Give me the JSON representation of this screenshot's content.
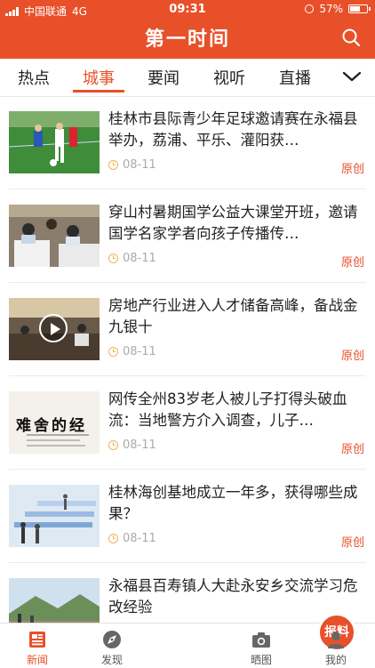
{
  "status_bar": {
    "carrier": "中国联通",
    "network": "4G",
    "time": "09:31",
    "battery": "57%",
    "battery_level": 0.57
  },
  "header": {
    "title": "第一时间",
    "search_icon": "search-icon",
    "brand_color": "#e8502a"
  },
  "tabs": [
    {
      "label": "热点",
      "active": false
    },
    {
      "label": "城事",
      "active": true
    },
    {
      "label": "要闻",
      "active": false
    },
    {
      "label": "视听",
      "active": false
    },
    {
      "label": "直播",
      "active": false
    }
  ],
  "more_icon": "chevron-down-icon",
  "articles": [
    {
      "title": "桂林市县际青少年足球邀请赛在永福县举办，荔浦、平乐、灌阳获…",
      "date": "08-11",
      "tag": "原创"
    },
    {
      "title": " 穿山村暑期国学公益大课堂开班，邀请国学名家学者向孩子传播传…",
      "date": "08-11",
      "tag": "原创"
    },
    {
      "title": "房地产行业进入人才储备高峰，备战金九银十",
      "date": "08-11",
      "tag": "原创",
      "video": true
    },
    {
      "title": "网传全州83岁老人被儿子打得头破血流：当地警方介入调查，儿子…",
      "date": "08-11",
      "tag": "原创",
      "thumb_text": "难舍的经"
    },
    {
      "title": "桂林海创基地成立一年多，获得哪些成果？",
      "date": "08-11",
      "tag": "原创"
    },
    {
      "title": "永福县百寿镇人大赴永安乡交流学习危改经验",
      "date": "",
      "tag": ""
    }
  ],
  "bottom_nav": [
    {
      "label": "新闻",
      "icon": "news-icon",
      "active": true
    },
    {
      "label": "发现",
      "icon": "compass-icon",
      "active": false
    },
    {
      "label": "报料",
      "icon": "report-button",
      "active": false
    },
    {
      "label": "晒图",
      "icon": "camera-icon",
      "active": false
    },
    {
      "label": "我的",
      "icon": "person-icon",
      "active": false
    }
  ]
}
